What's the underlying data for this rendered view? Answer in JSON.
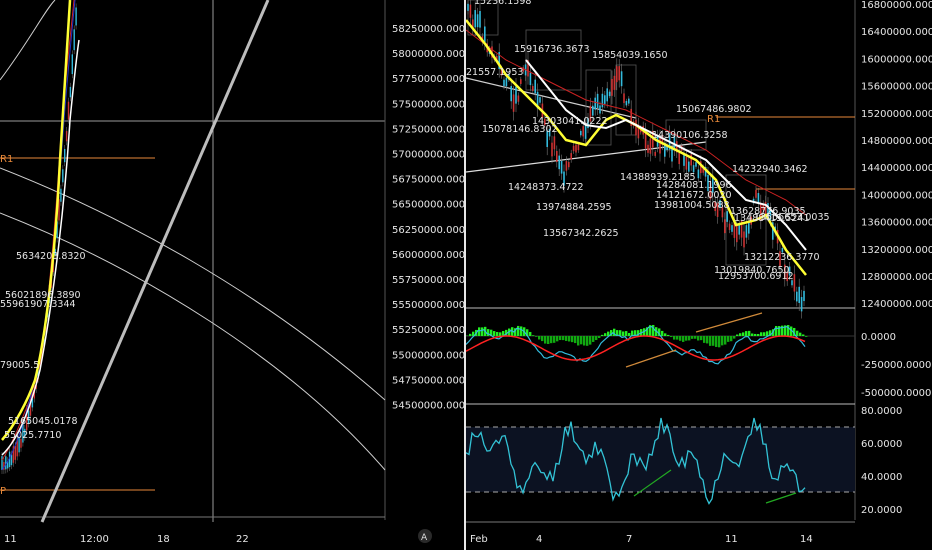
{
  "left_chart": {
    "price_axis": [
      "58250000.0000",
      "58000000.0000",
      "57750000.0000",
      "57500000.0000",
      "57250000.0000",
      "57000000.0000",
      "56750000.0000",
      "56500000.0000",
      "56250000.0000",
      "56000000.0000",
      "55750000.0000",
      "55500000.0000",
      "55250000.0000",
      "55000000.0000",
      "54750000.0000",
      "54500000.0000"
    ],
    "time_axis": [
      "11",
      "12:00",
      "18",
      "22"
    ],
    "pivot_labels": [
      "R1",
      "P"
    ],
    "price_labels": [
      "5634203.8320",
      "56021896.3890",
      "55961907.3344",
      "79005.5",
      "5165045.0178",
      "55025.7710"
    ],
    "auto_scale_label": "A",
    "colors": {
      "pivot": "#e8893a",
      "sma_fast": "#ffff33",
      "sma_slow": "#ffffff"
    }
  },
  "right_chart": {
    "price_axis": [
      "16800000.0000",
      "16400000.0000",
      "16000000.0000",
      "15600000.0000",
      "15200000.0000",
      "14800000.0000",
      "14400000.0000",
      "14000000.0000",
      "13600000.0000",
      "13200000.0000",
      "12800000.0000",
      "12400000.0000"
    ],
    "macd_axis": [
      "0.0000",
      "-250000.0000",
      "-500000.0000"
    ],
    "rsi_axis": [
      "80.0000",
      "60.0000",
      "40.0000",
      "20.0000"
    ],
    "time_axis": [
      "Feb",
      "4",
      "7",
      "11",
      "14"
    ],
    "pivot_labels": [
      "R1"
    ],
    "price_labels": [
      "15236.1598",
      "15916736.3673",
      "15854039.1650",
      "21557.1953",
      "15067486.9802",
      "15078146.8302",
      "14303041.0222",
      "14390106.3258",
      "14388939.2185",
      "14248373.4722",
      "14284081.1996",
      "14232940.3462",
      "13974884.2595",
      "14121672.0020",
      "13981004.5088",
      "13628776.9035",
      "13488415.5241",
      "13556653.0035",
      "13567342.2625",
      "13212236.3770",
      "13019840.7650",
      "12953700.6912"
    ],
    "colors": {
      "macd_hist_up": "#22ee22",
      "macd_hist_down": "#11aa11",
      "macd_signal": "#ff2222",
      "macd_line": "#33bbdd",
      "rsi": "#33c3d6",
      "divergence": "#d08a3a"
    }
  }
}
